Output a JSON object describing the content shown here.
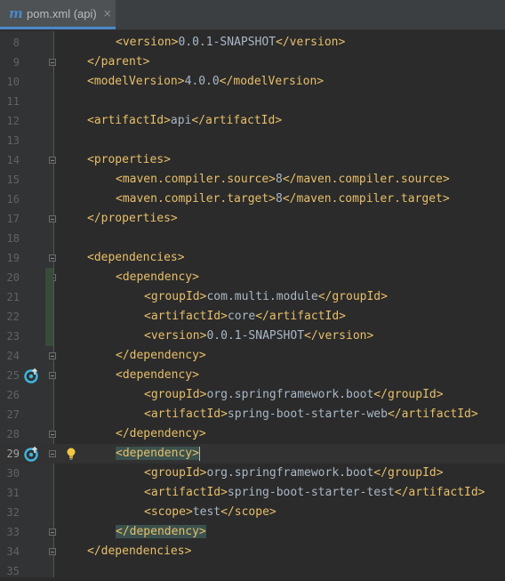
{
  "tab": {
    "icon": "maven-m-icon",
    "glyph": "m",
    "label": "pom.xml (api)",
    "close_glyph": "×"
  },
  "colors": {
    "background": "#2b2b2b",
    "tag": "#e8bf6a",
    "text": "#a9b7c6",
    "line_number": "#606366",
    "tab_accent": "#4a88c7"
  },
  "lines": [
    {
      "num": "8",
      "parts": [
        [
          "tag",
          "<version>"
        ],
        [
          "txt",
          "0.0.1-SNAPSHOT"
        ],
        [
          "tag",
          "</version>"
        ]
      ]
    },
    {
      "num": "9",
      "parts": [
        [
          "tag",
          "</parent>"
        ]
      ]
    },
    {
      "num": "10",
      "parts": [
        [
          "tag",
          "<modelVersion>"
        ],
        [
          "txt",
          "4.0.0"
        ],
        [
          "tag",
          "</modelVersion>"
        ]
      ]
    },
    {
      "num": "11",
      "parts": []
    },
    {
      "num": "12",
      "parts": [
        [
          "tag",
          "<artifactId>"
        ],
        [
          "txt",
          "api"
        ],
        [
          "tag",
          "</artifactId>"
        ]
      ]
    },
    {
      "num": "13",
      "parts": []
    },
    {
      "num": "14",
      "parts": [
        [
          "tag",
          "<properties>"
        ]
      ]
    },
    {
      "num": "15",
      "parts": [
        [
          "tag",
          "<maven.compiler.source>"
        ],
        [
          "txt",
          "8"
        ],
        [
          "tag",
          "</maven.compiler.source>"
        ]
      ]
    },
    {
      "num": "16",
      "parts": [
        [
          "tag",
          "<maven.compiler.target>"
        ],
        [
          "txt",
          "8"
        ],
        [
          "tag",
          "</maven.compiler.target>"
        ]
      ]
    },
    {
      "num": "17",
      "parts": [
        [
          "tag",
          "</properties>"
        ]
      ]
    },
    {
      "num": "18",
      "parts": []
    },
    {
      "num": "19",
      "parts": [
        [
          "tag",
          "<dependencies>"
        ]
      ]
    },
    {
      "num": "20",
      "parts": [
        [
          "tag",
          "<dependency>"
        ]
      ]
    },
    {
      "num": "21",
      "parts": [
        [
          "tag",
          "<groupId>"
        ],
        [
          "txt",
          "com.multi.module"
        ],
        [
          "tag",
          "</groupId>"
        ]
      ]
    },
    {
      "num": "22",
      "parts": [
        [
          "tag",
          "<artifactId>"
        ],
        [
          "txt",
          "core"
        ],
        [
          "tag",
          "</artifactId>"
        ]
      ]
    },
    {
      "num": "23",
      "parts": [
        [
          "tag",
          "<version>"
        ],
        [
          "txt",
          "0.0.1-SNAPSHOT"
        ],
        [
          "tag",
          "</version>"
        ]
      ]
    },
    {
      "num": "24",
      "parts": [
        [
          "tag",
          "</dependency>"
        ]
      ]
    },
    {
      "num": "25",
      "parts": [
        [
          "tag",
          "<dependency>"
        ]
      ]
    },
    {
      "num": "26",
      "parts": [
        [
          "tag",
          "<groupId>"
        ],
        [
          "txt",
          "org.springframework.boot"
        ],
        [
          "tag",
          "</groupId>"
        ]
      ]
    },
    {
      "num": "27",
      "parts": [
        [
          "tag",
          "<artifactId>"
        ],
        [
          "txt",
          "spring-boot-starter-web"
        ],
        [
          "tag",
          "</artifactId>"
        ]
      ]
    },
    {
      "num": "28",
      "parts": [
        [
          "tag",
          "</dependency>"
        ]
      ]
    },
    {
      "num": "29",
      "parts": [
        [
          "tag",
          "<dependency>"
        ]
      ]
    },
    {
      "num": "30",
      "parts": [
        [
          "tag",
          "<groupId>"
        ],
        [
          "txt",
          "org.springframework.boot"
        ],
        [
          "tag",
          "</groupId>"
        ]
      ]
    },
    {
      "num": "31",
      "parts": [
        [
          "tag",
          "<artifactId>"
        ],
        [
          "txt",
          "spring-boot-starter-test"
        ],
        [
          "tag",
          "</artifactId>"
        ]
      ]
    },
    {
      "num": "32",
      "parts": [
        [
          "tag",
          "<scope>"
        ],
        [
          "txt",
          "test"
        ],
        [
          "tag",
          "</scope>"
        ]
      ]
    },
    {
      "num": "33",
      "parts": [
        [
          "tag",
          "</dependency>"
        ]
      ]
    },
    {
      "num": "34",
      "parts": [
        [
          "tag",
          "</dependencies>"
        ]
      ]
    },
    {
      "num": "35",
      "parts": []
    }
  ],
  "current_line": "29",
  "gutter_icons": {
    "run_icon": "maven-override-icon",
    "intention_icon": "lightbulb-icon"
  }
}
